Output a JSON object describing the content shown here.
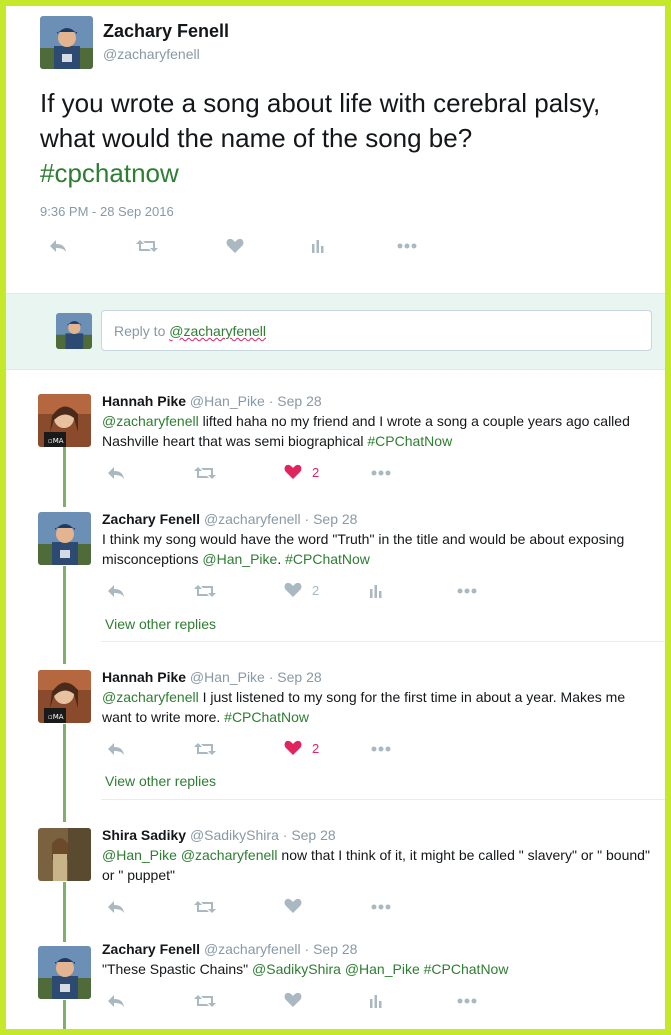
{
  "main": {
    "name": "Zachary Fenell",
    "handle": "@zacharyfenell",
    "text_plain": "If you wrote a song about life with cerebral palsy, what would the name of the song be?",
    "hashtag": "#cpchatnow",
    "timestamp": "9:36 PM - 28 Sep 2016"
  },
  "reply_box": {
    "placeholder_prefix": "Reply to ",
    "mention": "@zacharyfenell"
  },
  "replies": [
    {
      "name": "Hannah Pike",
      "handle": "@Han_Pike",
      "date": "Sep 28",
      "mention": "@zacharyfenell",
      "text": " lifted haha no  my friend and I wrote a song a couple years ago called Nashville heart that was semi biographical ",
      "hashtag": "#CPChatNow",
      "likes": "2",
      "liked": true
    },
    {
      "name": "Zachary Fenell",
      "handle": "@zacharyfenell",
      "date": "Sep 28",
      "text": "I think my song would have the word \"Truth\" in the title and would be about exposing misconceptions ",
      "mention": "@Han_Pike",
      "text_after": ". ",
      "hashtag": "#CPChatNow",
      "likes": "2",
      "liked": false,
      "view_other": "View other replies"
    },
    {
      "name": "Hannah Pike",
      "handle": "@Han_Pike",
      "date": "Sep 28",
      "mention": "@zacharyfenell",
      "text": " I just listened to my song for the first time in about a year. Makes me want to write more. ",
      "hashtag": "#CPChatNow",
      "likes": "2",
      "liked": true,
      "view_other": "View other replies"
    },
    {
      "name": "Shira Sadiky",
      "handle": "@SadikyShira",
      "date": "Sep 28",
      "mention": "@Han_Pike",
      "mention2": "@zacharyfenell",
      "text": " now that I think of it, it might be called \" slavery\" or \" bound\" or \" puppet\""
    },
    {
      "name": "Zachary Fenell",
      "handle": "@zacharyfenell",
      "date": "Sep 28",
      "text": "\"These Spastic Chains\" ",
      "mention": "@SadikyShira",
      "mention2": "@Han_Pike",
      "hashtag": "#CPChatNow"
    }
  ],
  "separator": " · ",
  "icons": [
    "reply-icon",
    "retweet-icon",
    "heart-icon",
    "analytics-icon",
    "more-icon"
  ],
  "colors": {
    "link": "#2e7d32",
    "like": "#e0245e",
    "muted": "#8899a6",
    "frame": "#c5e82a"
  }
}
